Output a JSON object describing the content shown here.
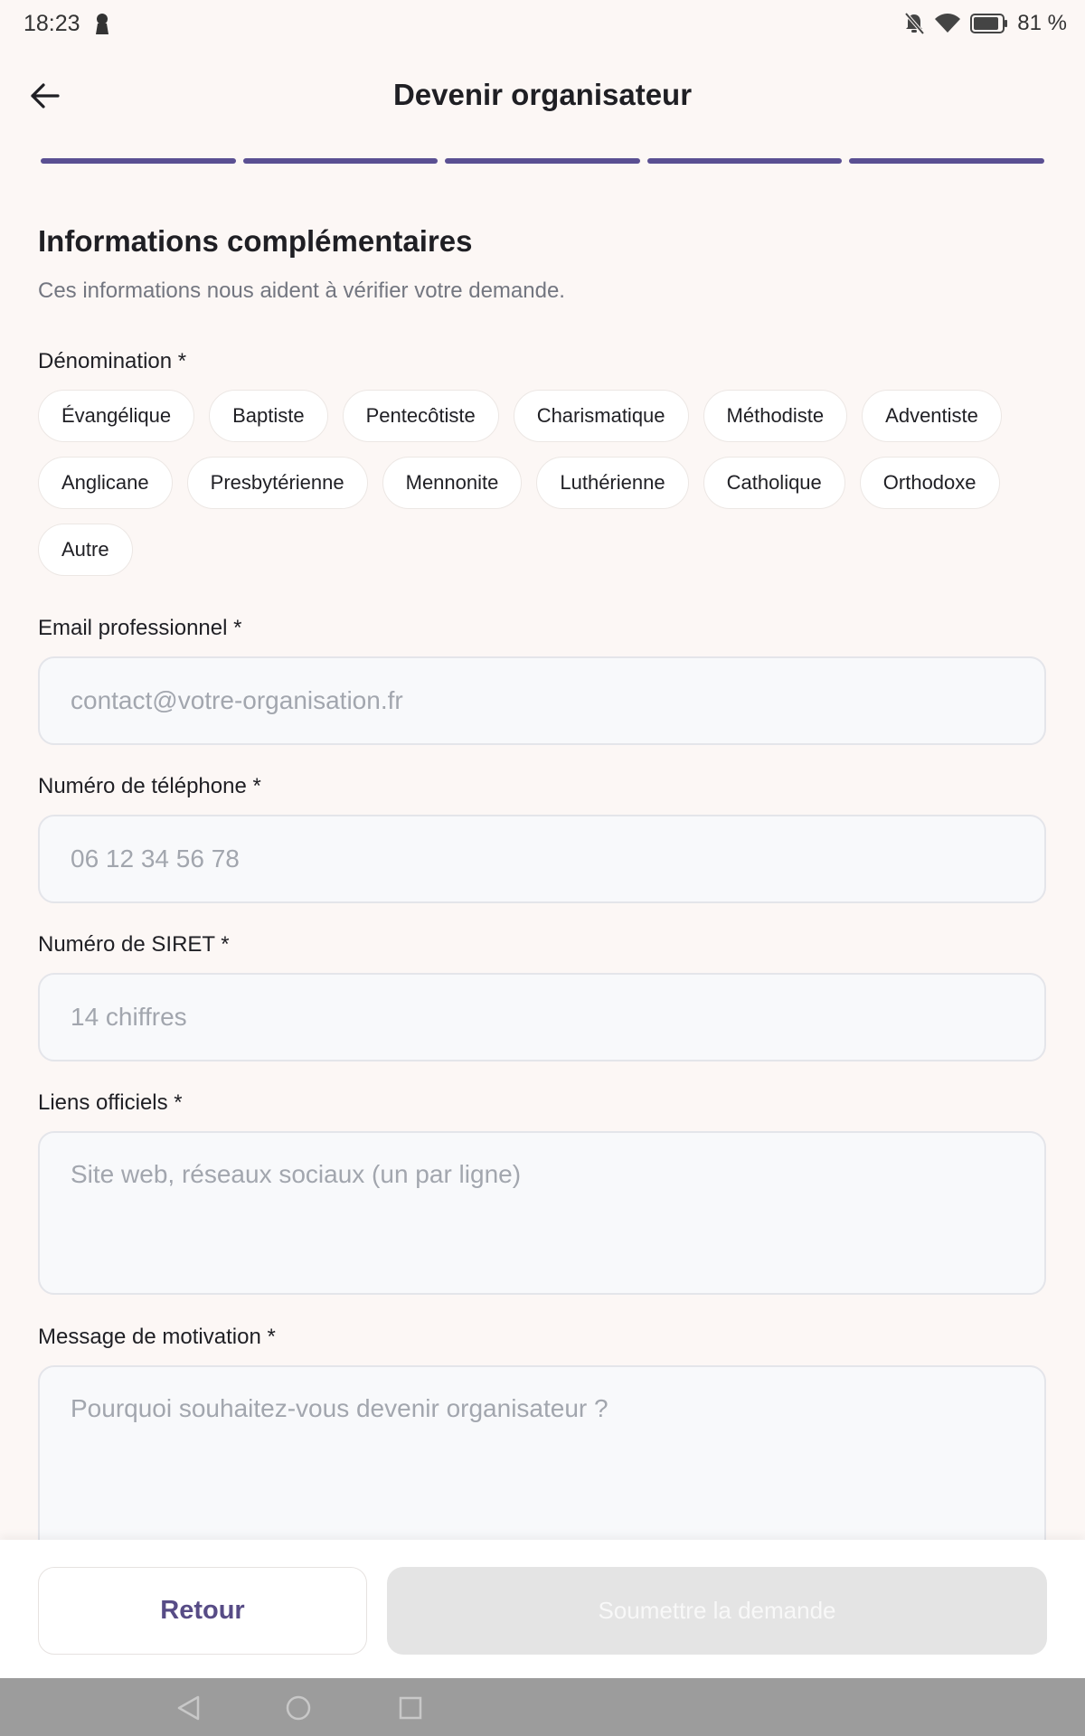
{
  "status": {
    "time": "18:23",
    "battery": "81 %"
  },
  "header": {
    "title": "Devenir organisateur"
  },
  "progress": {
    "steps_total": 5,
    "steps_done": 5
  },
  "section": {
    "title": "Informations complémentaires",
    "subtitle": "Ces informations nous aident à vérifier votre demande."
  },
  "denomination": {
    "label": "Dénomination *",
    "options": [
      "Évangélique",
      "Baptiste",
      "Pentecôtiste",
      "Charismatique",
      "Méthodiste",
      "Adventiste",
      "Anglicane",
      "Presbytérienne",
      "Mennonite",
      "Luthérienne",
      "Catholique",
      "Orthodoxe",
      "Autre"
    ]
  },
  "email": {
    "label": "Email professionnel *",
    "placeholder": "contact@votre-organisation.fr"
  },
  "phone": {
    "label": "Numéro de téléphone *",
    "placeholder": "06 12 34 56 78"
  },
  "siret": {
    "label": "Numéro de SIRET *",
    "placeholder": "14 chiffres"
  },
  "links": {
    "label": "Liens officiels *",
    "placeholder": "Site web, réseaux sociaux (un par ligne)"
  },
  "motivation": {
    "label": "Message de motivation *",
    "placeholder": "Pourquoi souhaitez-vous devenir organisateur ?"
  },
  "actions": {
    "back_label": "Retour",
    "submit_label": "Soumettre la demande"
  },
  "icons": {
    "back": "arrow-left-icon",
    "notifications_off": "bell-off-icon",
    "wifi": "wifi-icon",
    "battery": "battery-icon",
    "lock": "keyhole-icon",
    "nav_back": "triangle-back-icon",
    "nav_home": "circle-home-icon",
    "nav_recents": "square-recents-icon"
  },
  "colors": {
    "accent": "#5a4f92",
    "background": "#fcf7f5",
    "disabled": "#e4e4e4"
  }
}
